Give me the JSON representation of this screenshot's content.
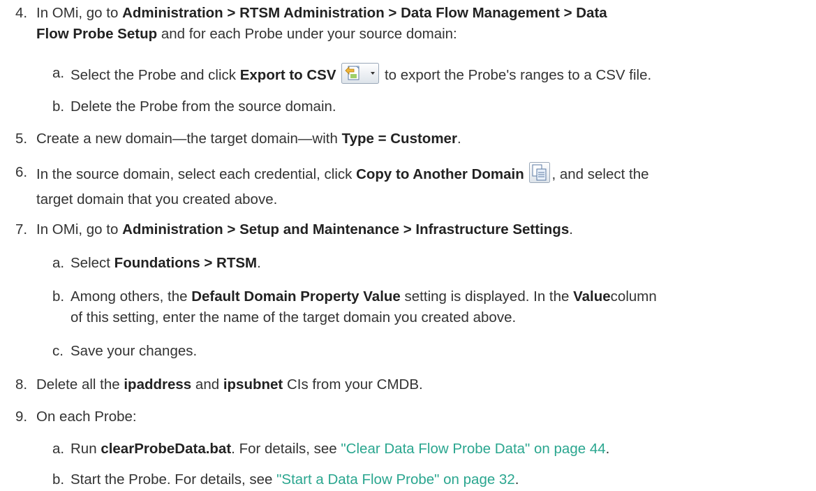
{
  "step4": {
    "num": "4.",
    "pre": "In OMi, go to ",
    "path": "Administration > RTSM Administration > Data Flow Management > Data",
    "path2": "Flow Probe Setup",
    "post": " and for each Probe under your source domain:",
    "a": {
      "num": "a.",
      "pre": "Select the Probe and click ",
      "bold": "Export to CSV",
      "post": " to export the Probe's ranges to a CSV file."
    },
    "b": {
      "num": "b.",
      "text": "Delete the Probe from the source domain."
    }
  },
  "step5": {
    "num": "5.",
    "pre": "Create a new domain—the target domain—with ",
    "bold": "Type = Customer",
    "post": "."
  },
  "step6": {
    "num": "6.",
    "pre": "In the source domain, select each credential, click ",
    "bold": "Copy to Another Domain",
    "post": ", and select the",
    "line2": "target domain that you created above."
  },
  "step7": {
    "num": "7.",
    "pre": "In OMi, go to ",
    "bold": "Administration > Setup and Maintenance > Infrastructure Settings",
    "post": ".",
    "a": {
      "num": "a.",
      "pre": "Select ",
      "bold": "Foundations > RTSM",
      "post": "."
    },
    "b": {
      "num": "b.",
      "pre": "Among others, the ",
      "bold": "Default Domain Property Value",
      "mid": " setting is displayed. In the ",
      "bold2": "Value",
      "post": "column",
      "line2": "of this setting, enter the name of the target domain you created above."
    },
    "c": {
      "num": "c.",
      "text": "Save your changes."
    }
  },
  "step8": {
    "num": "8.",
    "pre": "Delete all the ",
    "bold": "ipaddress",
    "mid": " and ",
    "bold2": "ipsubnet",
    "post": " CIs from your CMDB."
  },
  "step9": {
    "num": "9.",
    "text": "On each Probe:",
    "a": {
      "num": "a.",
      "pre": "Run ",
      "bold": "clearProbeData.bat",
      "mid": ". For details, see ",
      "link": "\"Clear Data Flow Probe Data\" on page 44",
      "post": "."
    },
    "b": {
      "num": "b.",
      "pre": "Start the Probe. For details, see ",
      "link": "\"Start a Data Flow Probe\" on page 32",
      "post": "."
    }
  },
  "icons": {
    "export": "export-csv-icon",
    "dropdown": "chevron-down-icon",
    "copy": "copy-to-domain-icon"
  }
}
